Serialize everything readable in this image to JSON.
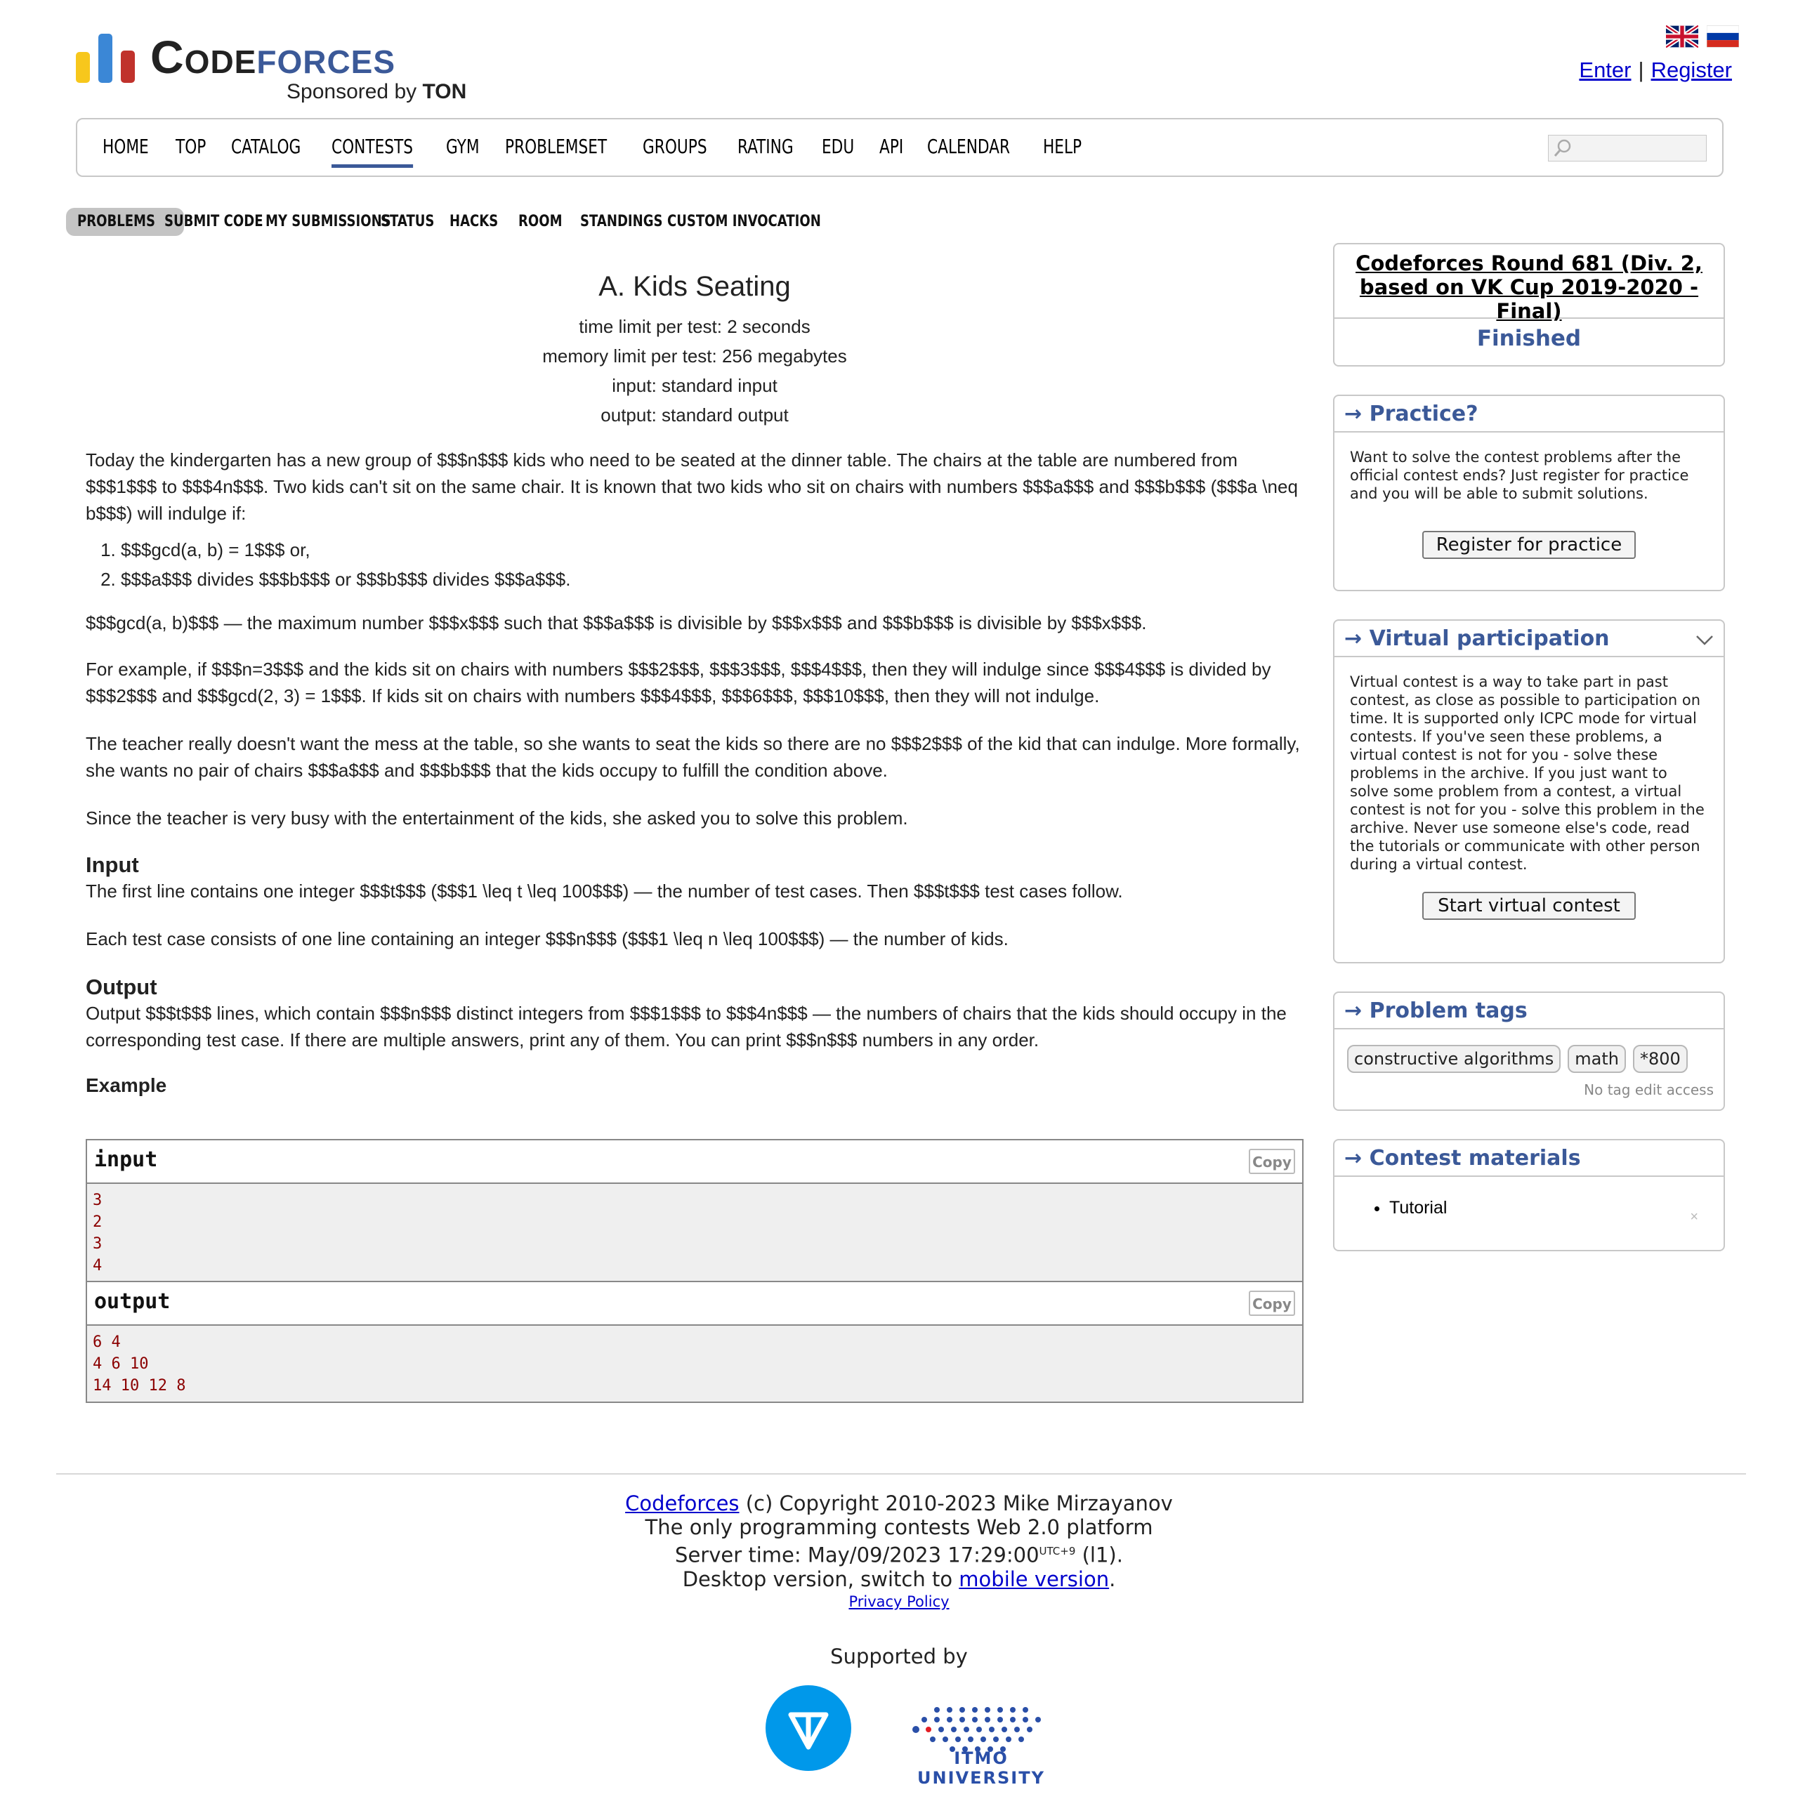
{
  "brand": {
    "word_code": "Code",
    "word_forces": "forces",
    "sponsor_prefix": "Sponsored by ",
    "sponsor_name": "TON",
    "bar_colors": [
      "#f7c71c",
      "#3b87d6",
      "#c0322c"
    ]
  },
  "auth": {
    "enter": "Enter",
    "separator": "|",
    "register": "Register"
  },
  "main_nav": {
    "items": [
      "HOME",
      "TOP",
      "CATALOG",
      "CONTESTS",
      "GYM",
      "PROBLEMSET",
      "GROUPS",
      "RATING",
      "EDU",
      "API",
      "CALENDAR",
      "HELP"
    ],
    "active": "CONTESTS",
    "search_placeholder": ""
  },
  "sub_nav": {
    "items": [
      "PROBLEMS",
      "SUBMIT CODE",
      "MY SUBMISSIONS",
      "STATUS",
      "HACKS",
      "ROOM",
      "STANDINGS",
      "CUSTOM INVOCATION"
    ],
    "active": "PROBLEMS"
  },
  "problem": {
    "title": "A. Kids Seating",
    "limits": [
      "time limit per test: 2 seconds",
      "memory limit per test: 256 megabytes",
      "input: standard input",
      "output: standard output"
    ],
    "statement_intro": "Today the kindergarten has a new group of $$$n$$$ kids who need to be seated at the dinner table. The chairs at the table are numbered from $$$1$$$ to $$$4n$$$. Two kids can't sit on the same chair. It is known that two kids who sit on chairs with numbers $$$a$$$ and $$$b$$$ ($$$a \\neq b$$$) will indulge if:",
    "conditions": [
      "$$$gcd(a, b) = 1$$$ or,",
      "$$$a$$$ divides $$$b$$$ or $$$b$$$ divides $$$a$$$."
    ],
    "gcd_note": "$$$gcd(a, b)$$$ — the maximum number $$$x$$$ such that $$$a$$$ is divisible by $$$x$$$ and $$$b$$$ is divisible by $$$x$$$.",
    "example_text": "For example, if $$$n=3$$$ and the kids sit on chairs with numbers $$$2$$$, $$$3$$$, $$$4$$$, then they will indulge since $$$4$$$ is divided by $$$2$$$ and $$$gcd(2, 3) = 1$$$. If kids sit on chairs with numbers $$$4$$$, $$$6$$$, $$$10$$$, then they will not indulge.",
    "teacher_text": "The teacher really doesn't want the mess at the table, so she wants to seat the kids so there are no $$$2$$$ of the kid that can indulge. More formally, she wants no pair of chairs $$$a$$$ and $$$b$$$ that the kids occupy to fulfill the condition above.",
    "busy_text": "Since the teacher is very busy with the entertainment of the kids, she asked you to solve this problem.",
    "input_title": "Input",
    "input_text_1": "The first line contains one integer $$$t$$$ ($$$1 \\leq t \\leq 100$$$) — the number of test cases. Then $$$t$$$ test cases follow.",
    "input_text_2": "Each test case consists of one line containing an integer $$$n$$$ ($$$1 \\leq n \\leq 100$$$) — the number of kids.",
    "output_title": "Output",
    "output_text": "Output $$$t$$$ lines, which contain $$$n$$$ distinct integers from $$$1$$$ to $$$4n$$$ — the numbers of chairs that the kids should occupy in the corresponding test case. If there are multiple answers, print any of them. You can print $$$n$$$ numbers in any order.",
    "example_title": "Example",
    "example": {
      "input_label": "input",
      "output_label": "output",
      "copy_label": "Copy",
      "input_lines": [
        "3",
        "2",
        "3",
        "4"
      ],
      "output_lines": [
        "6 4",
        "4 6 10",
        "14 10 12 8"
      ]
    }
  },
  "sidebar": {
    "round": {
      "title": "Codeforces Round 681 (Div. 2, based on VK Cup 2019-2020 - Final)",
      "status": "Finished"
    },
    "practice": {
      "title": "→ Practice?",
      "text": "Want to solve the contest problems after the official contest ends? Just register for practice and you will be able to submit solutions.",
      "button": "Register for practice"
    },
    "virtual": {
      "title": "→ Virtual participation",
      "text": "Virtual contest is a way to take part in past contest, as close as possible to participation on time. It is supported only ICPC mode for virtual contests. If you've seen these problems, a virtual contest is not for you - solve these problems in the archive. If you just want to solve some problem from a contest, a virtual contest is not for you - solve this problem in the archive. Never use someone else's code, read the tutorials or communicate with other person during a virtual contest.",
      "button": "Start virtual contest"
    },
    "tags": {
      "title": "→ Problem tags",
      "items": [
        "constructive algorithms",
        "math",
        "*800"
      ],
      "note": "No tag edit access"
    },
    "materials": {
      "title": "→ Contest materials",
      "items": [
        "Tutorial"
      ],
      "remove_glyph": "×"
    }
  },
  "footer": {
    "site_link": "Codeforces",
    "copyright": " (c) Copyright 2010-2023 Mike Mirzayanov",
    "tagline": "The only programming contests Web 2.0 platform",
    "server_time_prefix": "Server time: May/09/2023 17:29:00",
    "server_time_tz": "UTC+9",
    "server_time_suffix": " (l1).",
    "desktop_prefix": "Desktop version, switch to ",
    "mobile_link": "mobile version",
    "desktop_suffix": ".",
    "privacy": "Privacy Policy",
    "supported_by": "Supported by",
    "itmo_name": "ITMO UNIVERSITY"
  },
  "icons": {
    "search": "search-icon",
    "flag_en": "flag-uk-icon",
    "flag_ru": "flag-ru-icon",
    "chevron": "chevron-down-icon"
  },
  "colors": {
    "accent": "#3b5998",
    "link": "#0000cc",
    "ton_blue": "#0098ea",
    "itmo_blue": "#2a4fa8",
    "itmo_red": "#e31e24"
  }
}
